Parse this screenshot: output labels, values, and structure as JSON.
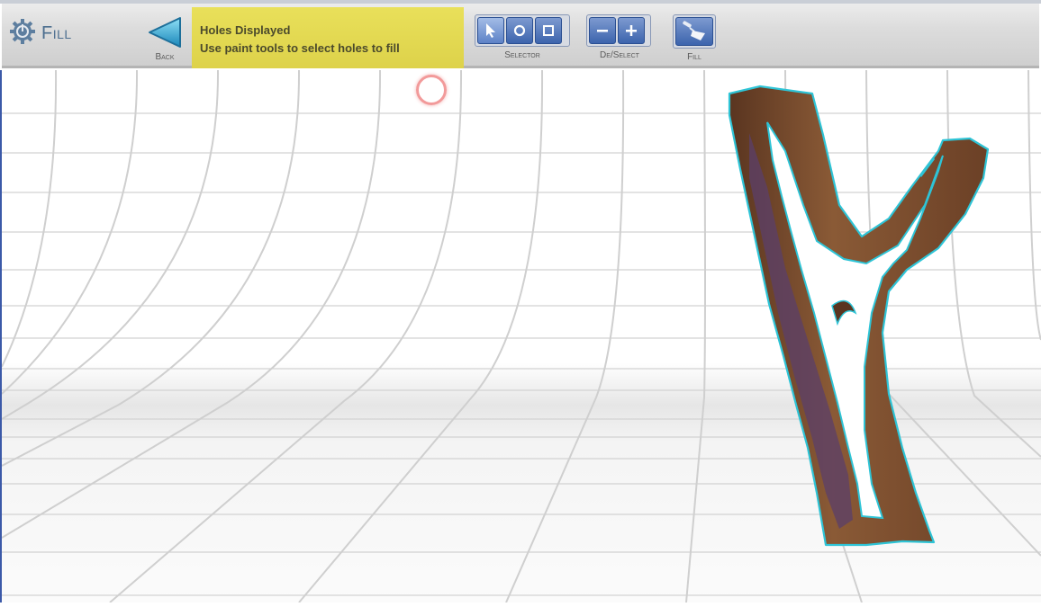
{
  "app": {
    "title": "Fill",
    "icon": "gear-power-icon"
  },
  "toolbar": {
    "back_label": "Back",
    "message_title": "Holes Displayed",
    "message_body": "Use paint tools to select holes to fill",
    "selector_label": "Selector",
    "deselect_label": "De/Select",
    "fill_label": "Fill"
  },
  "icons": {
    "back": "triangle-left-icon",
    "pointer": "arrow-pointer-icon",
    "circle": "circle-select-icon",
    "square": "square-select-icon",
    "minus": "minus-icon",
    "plus": "plus-icon",
    "fill": "trowel-fill-icon"
  },
  "colors": {
    "message_bg": "#e2d94f",
    "button_blue": "#3c64ad",
    "hole_outline": "#2ec4d6",
    "cursor_ring": "#f29a9a"
  }
}
